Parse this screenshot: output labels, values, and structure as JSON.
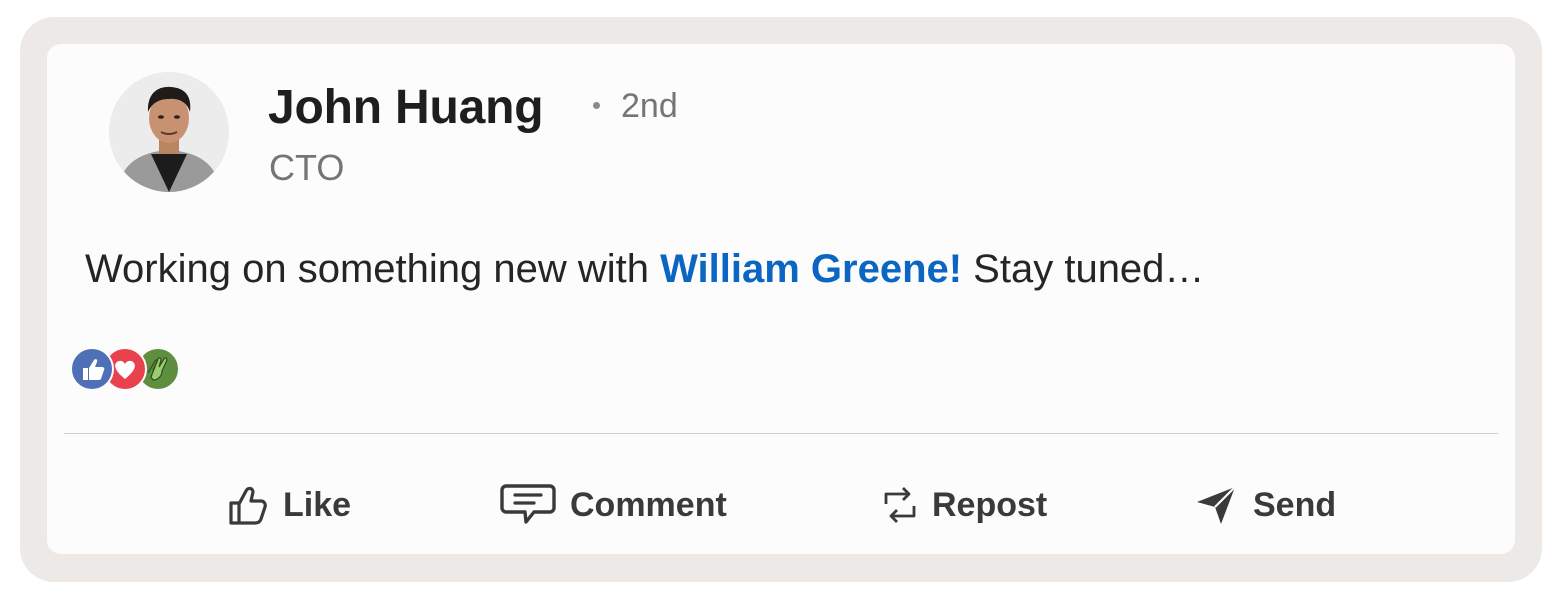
{
  "post": {
    "author": {
      "name": "John Huang",
      "connection_degree": "2nd",
      "headline": "CTO"
    },
    "text_before": "Working on something new with ",
    "mention": "William Greene!",
    "text_after": " Stay tuned…",
    "reactions": [
      "like",
      "love",
      "clap"
    ]
  },
  "actions": {
    "like": "Like",
    "comment": "Comment",
    "repost": "Repost",
    "send": "Send"
  },
  "colors": {
    "mention": "#0a66c2",
    "like_reaction": "#4f6fb6",
    "love_reaction": "#e9414e",
    "clap_reaction": "#5f8f3e"
  }
}
